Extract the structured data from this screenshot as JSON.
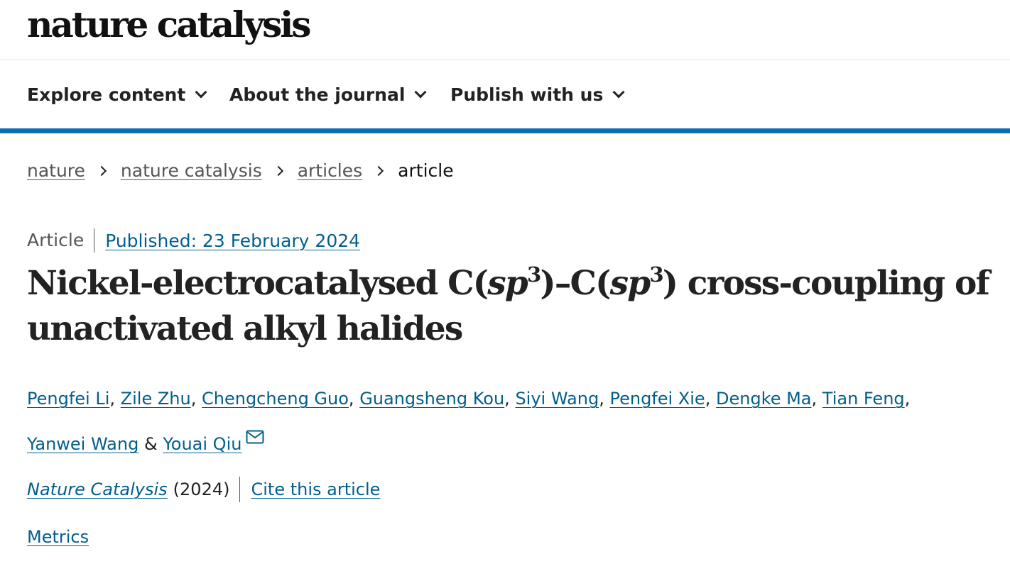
{
  "header": {
    "logo_text": "nature catalysis"
  },
  "nav": {
    "items": [
      {
        "label": "Explore content"
      },
      {
        "label": "About the journal"
      },
      {
        "label": "Publish with us"
      }
    ],
    "accent_color": "#0a6eb4"
  },
  "breadcrumb": {
    "items": [
      "nature",
      "nature catalysis",
      "articles"
    ],
    "current": "article"
  },
  "article": {
    "type": "Article",
    "published": "Published: 23 February 2024",
    "title_parts": {
      "t1": "Nickel-electrocatalysed C(",
      "sp_a": "sp",
      "sup_a": "3",
      "t2": ")–C(",
      "sp_b": "sp",
      "sup_b": "3",
      "t3": ") cross-coupling of unactivated alkyl halides"
    },
    "authors": [
      "Pengfei Li",
      "Zile Zhu",
      "Chengcheng Guo",
      "Guangsheng Kou",
      "Siyi Wang",
      "Pengfei Xie",
      "Dengke Ma",
      "Tian Feng",
      "Yanwei Wang",
      "Youai Qiu"
    ],
    "author_separators": {
      "comma": ",",
      "amp": "&"
    },
    "journal": "Nature Catalysis",
    "year": "(2024)",
    "cite_label": "Cite this article",
    "metrics_label": "Metrics"
  },
  "icons": {
    "nav_chevron": "chevron-down-icon",
    "breadcrumb_sep": "chevron-right-icon",
    "corresponding_author": "mail-icon"
  },
  "colors": {
    "link": "#025e8d",
    "text": "#222222"
  }
}
